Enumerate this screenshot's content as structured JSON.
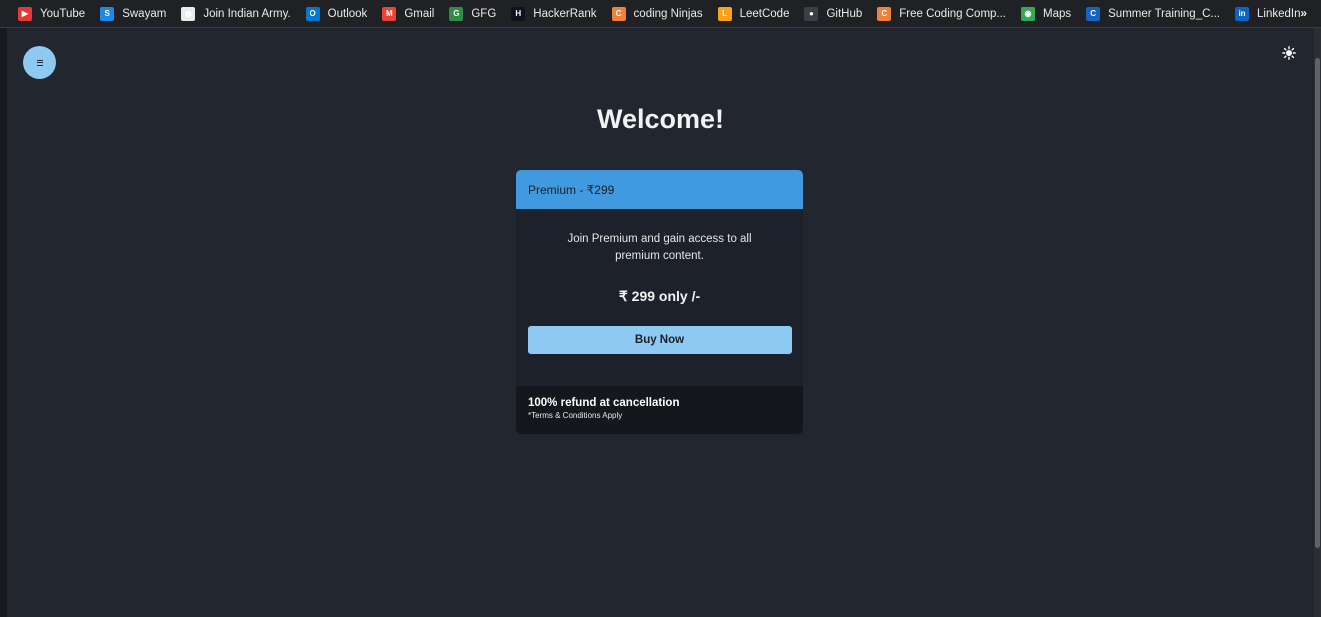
{
  "bookmarks": [
    {
      "label": "YouTube",
      "icon": "youtube-icon",
      "color": "#e53935",
      "glyph": "▶"
    },
    {
      "label": "Swayam",
      "icon": "swayam-icon",
      "color": "#1e88e5",
      "glyph": "S"
    },
    {
      "label": "Join Indian Army.",
      "icon": "globe-icon",
      "color": "#e8eaed",
      "glyph": "◍"
    },
    {
      "label": "Outlook",
      "icon": "outlook-icon",
      "color": "#0078d4",
      "glyph": "O"
    },
    {
      "label": "Gmail",
      "icon": "gmail-icon",
      "color": "#ea4335",
      "glyph": "M"
    },
    {
      "label": "GFG",
      "icon": "gfg-icon",
      "color": "#2f8d46",
      "glyph": "G"
    },
    {
      "label": "HackerRank",
      "icon": "hackerrank-icon",
      "color": "#0e141e",
      "glyph": "H"
    },
    {
      "label": "coding Ninjas",
      "icon": "codingninjas-icon",
      "color": "#f0813a",
      "glyph": "C"
    },
    {
      "label": "LeetCode",
      "icon": "leetcode-icon",
      "color": "#ffa116",
      "glyph": "L"
    },
    {
      "label": "GitHub",
      "icon": "github-icon",
      "color": "#3c3f44",
      "glyph": "●"
    },
    {
      "label": "Free Coding Comp...",
      "icon": "codingninjas-icon",
      "color": "#f0813a",
      "glyph": "C"
    },
    {
      "label": "Maps",
      "icon": "maps-pin-icon",
      "color": "#34a853",
      "glyph": "◉"
    },
    {
      "label": "Summer Training_C...",
      "icon": "summer-training-icon",
      "color": "#1565c0",
      "glyph": "C"
    },
    {
      "label": "LinkedIn",
      "icon": "linkedin-icon",
      "color": "#0a66c2",
      "glyph": "in"
    }
  ],
  "overflow_chevron": "»",
  "colors": {
    "background": "#21262f",
    "card_header": "#4199e0",
    "button": "#8ec9f2",
    "card_body": "#1c212b",
    "card_footer": "#14171c"
  },
  "main": {
    "title": "Welcome!"
  },
  "card": {
    "header": "Premium - ₹299",
    "description": "Join Premium and gain access to all premium content.",
    "price": "₹ 299 only /-",
    "button_label": "Buy Now",
    "refund_text": "100% refund at cancellation",
    "terms_text": "*Terms & Conditions Apply"
  }
}
